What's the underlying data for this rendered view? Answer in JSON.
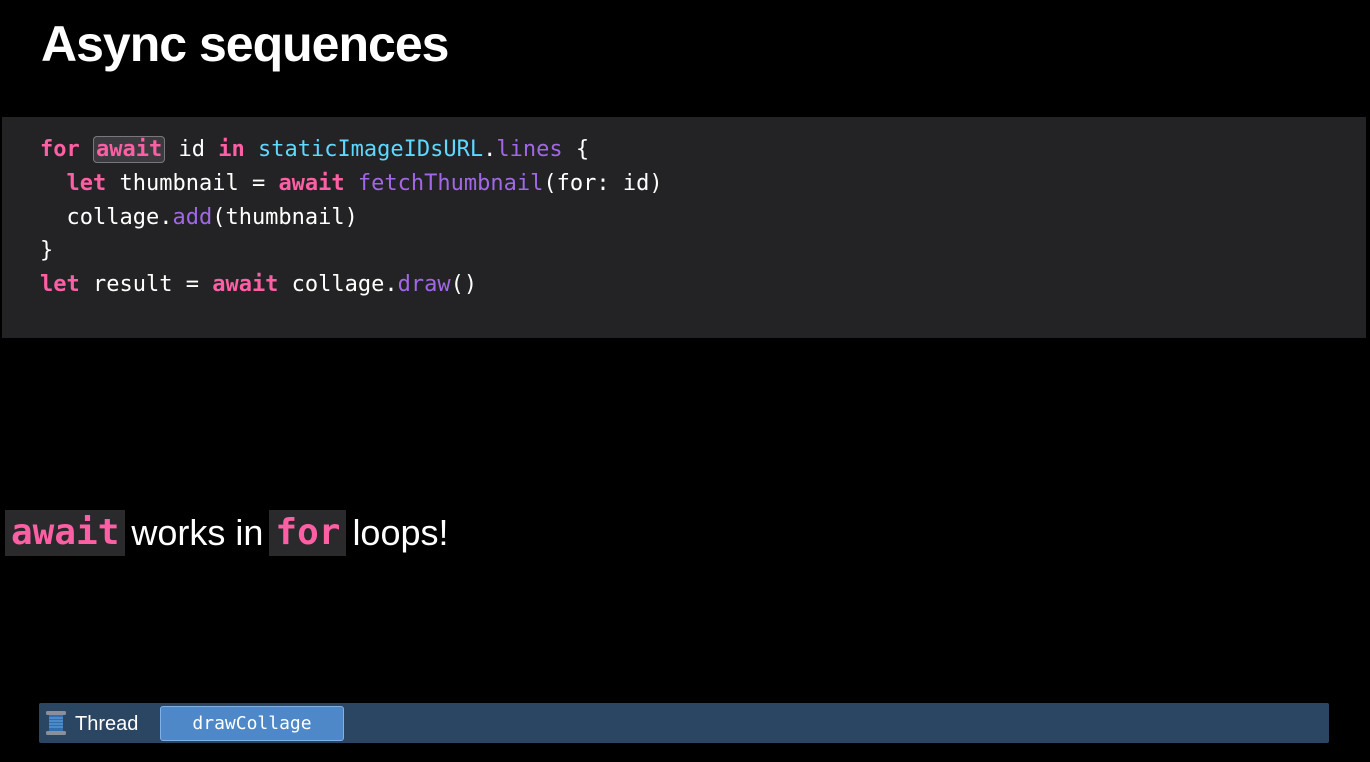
{
  "slide": {
    "title": "Async sequences"
  },
  "code": {
    "line1": {
      "kw_for": "for",
      "kw_await": "await",
      "id": " id ",
      "kw_in": "in",
      "space": " ",
      "type": "staticImageIDsURL",
      "dot": ".",
      "prop": "lines",
      "brace": " {"
    },
    "line2": {
      "indent": "  ",
      "kw_let": "let",
      "mid": " thumbnail = ",
      "kw_await": "await",
      "space": " ",
      "fn": "fetchThumbnail",
      "args": "(for: id)"
    },
    "line3": {
      "pre": "  collage.",
      "fn": "add",
      "args": "(thumbnail)"
    },
    "line4": {
      "text": "}"
    },
    "line5": {
      "kw_let": "let",
      "mid": " result = ",
      "kw_await": "await",
      "obj": " collage.",
      "fn": "draw",
      "args": "()"
    }
  },
  "caption": {
    "chip1": "await",
    "text1": "works in",
    "chip2": "for",
    "text2": "loops!"
  },
  "thread_bar": {
    "icon": "thread-spool-icon",
    "label": "Thread",
    "task": "drawCollage"
  },
  "colors": {
    "background": "#000000",
    "code_panel": "#232325",
    "keyword": "#fc5fa3",
    "type": "#5dd8ff",
    "method": "#a167e6",
    "thread_bar": "#2a4663",
    "task_chip": "#4e88c9"
  }
}
